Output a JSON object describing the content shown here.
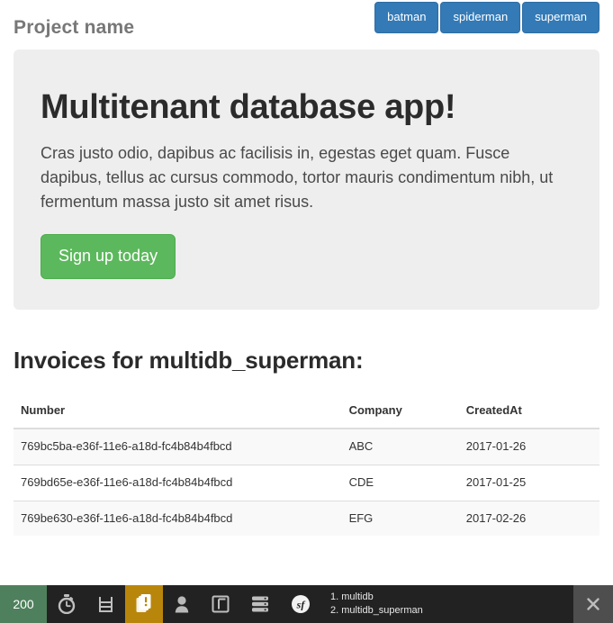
{
  "header": {
    "brand": "Project name",
    "nav": [
      {
        "label": "batman",
        "name": "nav-button-batman"
      },
      {
        "label": "spiderman",
        "name": "nav-button-spiderman"
      },
      {
        "label": "superman",
        "name": "nav-button-superman"
      }
    ]
  },
  "jumbotron": {
    "title": "Multitenant database app!",
    "text": "Cras justo odio, dapibus ac facilisis in, egestas eget quam. Fusce dapibus, tellus ac cursus commodo, tortor mauris condimentum nibh, ut fermentum massa justo sit amet risus.",
    "cta_label": "Sign up today"
  },
  "invoices": {
    "heading": "Invoices for multidb_superman:",
    "columns": {
      "number": "Number",
      "company": "Company",
      "created_at": "CreatedAt"
    },
    "rows": [
      {
        "number": "769bc5ba-e36f-11e6-a18d-fc4b84b4fbcd",
        "company": "ABC",
        "created_at": "2017-01-26"
      },
      {
        "number": "769bd65e-e36f-11e6-a18d-fc4b84b4fbcd",
        "company": "CDE",
        "created_at": "2017-01-25"
      },
      {
        "number": "769be630-e36f-11e6-a18d-fc4b84b4fbcd",
        "company": "EFG",
        "created_at": "2017-02-26"
      }
    ]
  },
  "debug_toolbar": {
    "status_code": "200",
    "icons": [
      "stopwatch-icon",
      "memory-icon",
      "logs-exception-icon",
      "security-user-icon",
      "twig-template-icon",
      "database-icon",
      "symfony-logo-icon"
    ],
    "database_lines": [
      "1. multidb",
      "2. multidb_superman"
    ],
    "close_label": "✕"
  },
  "colors": {
    "primary": "#337ab7",
    "success": "#5cb85c",
    "jumbotron_bg": "#eeeeee",
    "toolbar_bg": "#222222",
    "status_ok": "#4f805d",
    "warning": "#b8860b",
    "brand_text": "#777777"
  }
}
